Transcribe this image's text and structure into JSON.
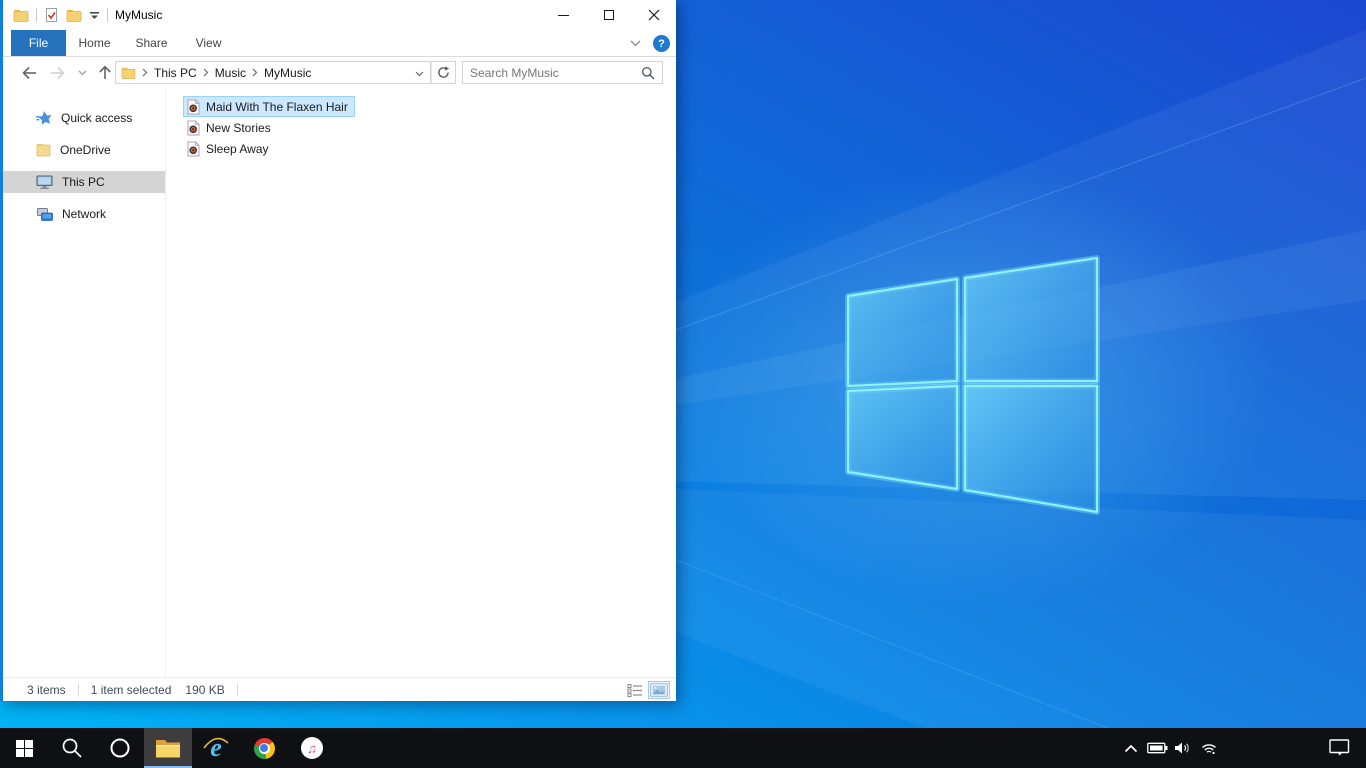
{
  "colors": {
    "accent_blue": "#2673bd",
    "selection_bg": "#cce8ff",
    "selection_border": "#99d1ff",
    "sidebar_selection": "#d4d4d4",
    "wallpaper_top_right": "#1c47d0",
    "wallpaper_bottom_left": "#00b7f6",
    "logo_stroke": "#8ef2fc",
    "taskbar_bg": "#0f1013",
    "taskbar_active_underline": "#85bdf2"
  },
  "titlebar": {
    "title": "MyMusic",
    "qat_icons": [
      "folder-icon",
      "properties-check-icon",
      "new-folder-icon",
      "qat-dropdown-icon"
    ],
    "caption_buttons": [
      "minimize",
      "maximize",
      "close"
    ]
  },
  "ribbon": {
    "tabs": [
      {
        "label": "File"
      },
      {
        "label": "Home"
      },
      {
        "label": "Share"
      },
      {
        "label": "View"
      }
    ],
    "help_glyph": "?",
    "controls": [
      "collapse-ribbon-chevron",
      "help"
    ]
  },
  "address": {
    "crumbs": [
      {
        "label": "This PC"
      },
      {
        "label": "Music"
      },
      {
        "label": "MyMusic"
      }
    ],
    "icons": [
      "back",
      "forward",
      "recent-locations-chevron",
      "up",
      "address-folder",
      "address-dropdown",
      "refresh"
    ]
  },
  "search": {
    "placeholder": "Search MyMusic"
  },
  "sidebar": {
    "items": [
      {
        "label": "Quick access",
        "icon": "quick-access-star",
        "selected": false
      },
      {
        "label": "OneDrive",
        "icon": "onedrive-folder",
        "selected": false
      },
      {
        "label": "This PC",
        "icon": "this-pc-monitor",
        "selected": true
      },
      {
        "label": "Network",
        "icon": "network-computer",
        "selected": false
      }
    ]
  },
  "files": [
    {
      "name": "Maid With The Flaxen Hair",
      "icon": "audio-file-icon",
      "selected": true
    },
    {
      "name": "New Stories",
      "icon": "audio-file-icon",
      "selected": false
    },
    {
      "name": "Sleep Away",
      "icon": "audio-file-icon",
      "selected": false
    }
  ],
  "status": {
    "count": "3 items",
    "selected": "1 item selected",
    "size": "190 KB",
    "view_buttons": [
      "details-view",
      "large-thumbnails-view"
    ],
    "active_view": "large-thumbnails-view"
  },
  "taskbar": {
    "apps": [
      "start",
      "search",
      "cortana",
      "file-explorer",
      "internet-explorer",
      "chrome",
      "itunes"
    ],
    "active_app": "file-explorer",
    "tray": [
      "hidden-icons-chevron",
      "battery",
      "volume",
      "wifi",
      "action-center"
    ],
    "itunes_glyph": "♫"
  }
}
